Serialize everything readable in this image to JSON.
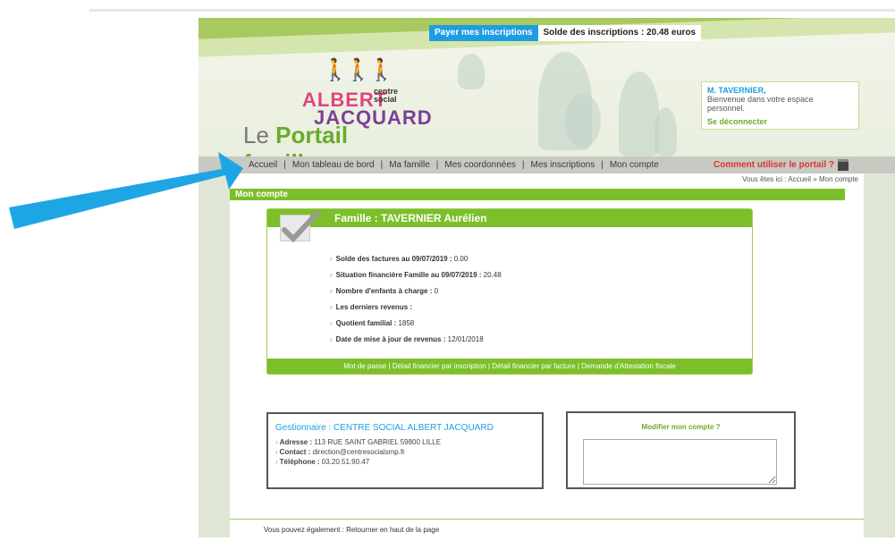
{
  "topbar": {
    "pay_label": "Payer mes inscriptions",
    "balance_text": "Solde des inscriptions : 20.48 euros"
  },
  "logo": {
    "centre": "centre",
    "social": "social",
    "albert": "ALBERT",
    "jacquard": "JACQUARD",
    "portail_prefix": "Le ",
    "portail_main": "Portail familles"
  },
  "welcome": {
    "name": "M. TAVERNIER,",
    "greeting": "Bienvenue dans votre espace personnel.",
    "logout": "Se déconnecter"
  },
  "nav": {
    "items": [
      "Accueil",
      "Mon tableau de bord",
      "Ma famille",
      "Mes coordonnées",
      "Mes inscriptions",
      "Mon compte"
    ],
    "separator": "|",
    "help": "Comment utiliser le portail ?"
  },
  "breadcrumb": {
    "prefix": "Vous êtes ici : ",
    "home": "Accueil",
    "sep": " » ",
    "current": "Mon compte"
  },
  "section_title": "Mon compte",
  "family": {
    "title": "Famille : TAVERNIER Aurélien",
    "rows": [
      {
        "label": "Solde des factures au 09/07/2019 :",
        "value": " 0.00"
      },
      {
        "label": "Situation financière Famille au 09/07/2019 :",
        "value": " 20.48"
      },
      {
        "label": "Nombre d'enfants à charge :",
        "value": " 0"
      },
      {
        "label": "Les derniers revenus :",
        "value": ""
      },
      {
        "label": "Quotient familial :",
        "value": " 1858"
      },
      {
        "label": "Date de mise à jour de revenus :",
        "value": " 12/01/2018"
      }
    ],
    "footer_links": [
      "Mot de passe",
      "Détail financier par inscription",
      "Détail financier par facture",
      "Demande d'Attestation fiscale"
    ]
  },
  "manager": {
    "title": "Gestionnaire : CENTRE SOCIAL ALBERT JACQUARD",
    "address_label": "Adresse :",
    "address": " 113 RUE SAINT GABRIEL 59800 LILLE",
    "contact_label": "Contact :",
    "contact": " direction@centresocialsmp.fr",
    "phone_label": "Téléphone :",
    "phone": " 03.20.51.90.47"
  },
  "modify": {
    "title": "Modifier mon compte ?"
  },
  "footer": {
    "prefix": "Vous pouvez également : ",
    "link": "Retourner en haut de la page"
  },
  "colors": {
    "accent_green": "#7cbf2a",
    "accent_blue": "#1e9ee1",
    "arrow_blue": "#1ea6e4",
    "help_red": "#e0332d"
  }
}
